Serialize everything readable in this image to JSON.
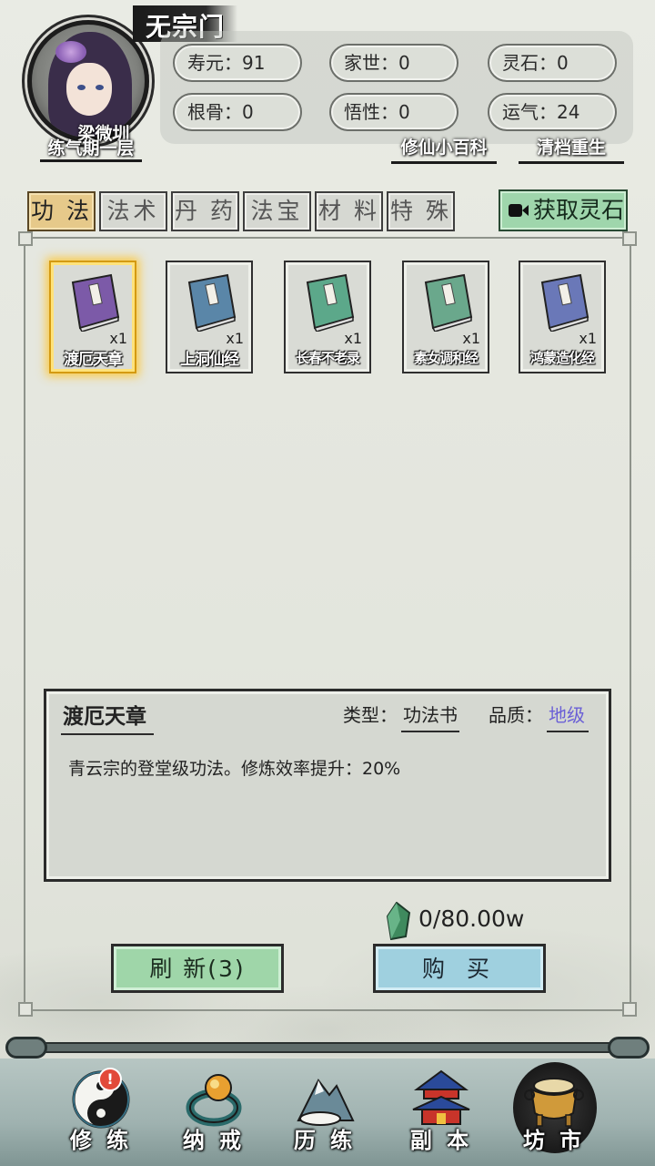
{
  "header": {
    "sect": "无宗门",
    "player_name": "梁微圳",
    "realm": "练气期一层",
    "stats": [
      {
        "label": "寿元：",
        "value": "91"
      },
      {
        "label": "家世：",
        "value": "0"
      },
      {
        "label": "灵石：",
        "value": "0"
      },
      {
        "label": "根骨：",
        "value": "0"
      },
      {
        "label": "悟性：",
        "value": "0"
      },
      {
        "label": "运气：",
        "value": "24"
      }
    ],
    "links": {
      "wiki": "修仙小百科",
      "reset": "清档重生"
    }
  },
  "tabs": [
    "功 法",
    "法术",
    "丹 药",
    "法宝",
    "材 料",
    "特 殊"
  ],
  "active_tab": 0,
  "get_stone_label": "获取灵石",
  "items": [
    {
      "name": "渡厄天章",
      "qty": "x1",
      "selected": true,
      "book_color": "#7c5aa8"
    },
    {
      "name": "上洞仙经",
      "qty": "x1",
      "selected": false,
      "book_color": "#5a86a8"
    },
    {
      "name": "长春不老录",
      "qty": "x1",
      "selected": false,
      "book_color": "#5ca88a"
    },
    {
      "name": "素女调和经",
      "qty": "x1",
      "selected": false,
      "book_color": "#6aa88c"
    },
    {
      "name": "鸿蒙造化经",
      "qty": "x1",
      "selected": false,
      "book_color": "#6a78b8"
    }
  ],
  "detail": {
    "title": "渡厄天章",
    "type_label": "类型：",
    "type_value": "功法书",
    "quality_label": "品质：",
    "quality_value": "地级",
    "quality_color": "#6a5fd6",
    "description": "青云宗的登堂级功法。修炼效率提升：20%"
  },
  "price": "0/80.00w",
  "buttons": {
    "refresh": "刷 新(3)",
    "buy": "购 买"
  },
  "nav": [
    {
      "label": "修 练",
      "icon": "yin-yang-icon",
      "badge": "!"
    },
    {
      "label": "纳 戒",
      "icon": "ring-icon"
    },
    {
      "label": "历 练",
      "icon": "mountain-icon"
    },
    {
      "label": "副 本",
      "icon": "pagoda-icon"
    },
    {
      "label": "坊 市",
      "icon": "cauldron-icon",
      "active": true
    }
  ]
}
